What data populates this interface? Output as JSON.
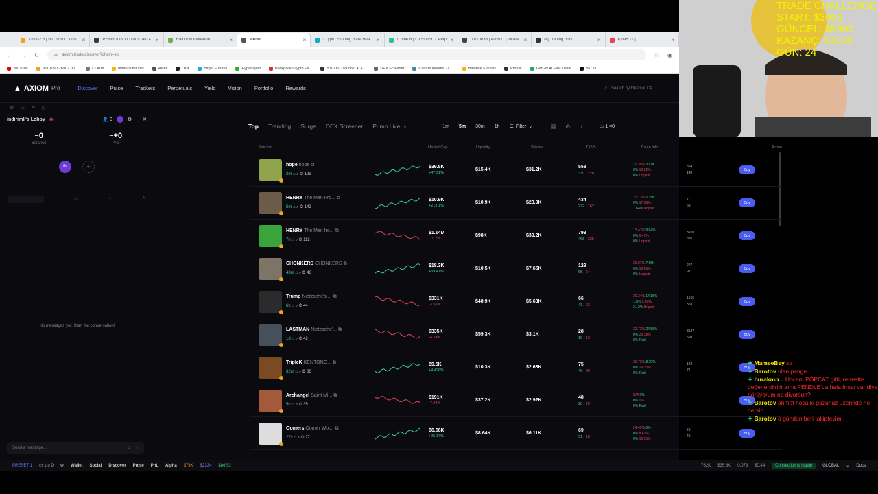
{
  "browser": {
    "tabs": [
      "78,032.5 | BTCUSD COIN",
      "PENGUUSDT 0.009148 ▲",
      "Rainbow İndikatörü",
      "Axiom",
      "Crypto Funding Rate Hea",
      "0.03408 | CTSI/USDT Perp",
      "0.010636 | 4USDT | Ticare",
      "My trading bots",
      "4,996.11 |"
    ],
    "active_tab": 3,
    "url": "axiom.trade/discover?chain=sol",
    "bookmarks": [
      "YouTube",
      "BTCUSD 26902.00...",
      "CLAIM",
      "binance futures",
      "Aster",
      "OKX",
      "Bitget Futures",
      "Hyperliquid",
      "Backpack Crypto Ex...",
      "BTCUSD 69.837 ▲ +...",
      "DEX Screener",
      "Coin Muhendisi - C...",
      "Binance Futures",
      "PropW",
      "GMGN AI Fast Trade",
      "BTCU"
    ]
  },
  "app": {
    "logo": "AXIOM",
    "logo_suffix": "Pro",
    "nav": [
      "Discover",
      "Pulse",
      "Trackers",
      "Perpetuals",
      "Yield",
      "Vision",
      "Portfolio",
      "Rewards"
    ],
    "active_nav": 0,
    "search_placeholder": "Search by token or CA...",
    "search_shortcut": "/",
    "lobby": {
      "title": "indirimli's Lobby",
      "count": "0",
      "balance": "0",
      "balance_label": "Balance",
      "pnl": "+0",
      "pnl_label": "PNL",
      "avatar": "IN",
      "empty": "No messages yet. Start the conversation!",
      "send_placeholder": "Send a message..."
    },
    "filters": {
      "tabs": [
        "Top",
        "Trending",
        "Surge",
        "DEX Screener",
        "Pump Live"
      ],
      "timeframes": [
        "1m",
        "5m",
        "30m",
        "1h"
      ],
      "active_tf": 1,
      "filter_label": "Filter",
      "count_label": "1",
      "zero_label": "0"
    },
    "columns": [
      "Pair Info",
      "Market Cap",
      "Liquidity",
      "Volume",
      "TXNS",
      "Token Info",
      "Action"
    ],
    "rows": [
      {
        "name": "hope",
        "sub": "hope",
        "age": "3m",
        "holders": "199",
        "mc": "$39.5K",
        "chg": "+47.91%",
        "dir": "up",
        "liq": "$15.4K",
        "vol": "$31.2K",
        "tx": "558",
        "buys": "330",
        "sells": "228",
        "i1": "22.39%",
        "i2": "3.91K",
        "i3": "0%",
        "i4": "18.22%",
        "i5": "0%",
        "i6": "Unpaid",
        "h1": "354",
        "h2": "143",
        "color": "#8fa34a"
      },
      {
        "name": "HENRY",
        "sub": "The Man Fro...",
        "age": "5m",
        "holders": "142",
        "mc": "$10.9K",
        "chg": "+213.1%",
        "dir": "up",
        "liq": "$10.9K",
        "vol": "$23.9K",
        "tx": "434",
        "buys": "272",
        "sells": "162",
        "i1": "23.12%",
        "i2": "2.38K",
        "i3": "0%",
        "i4": "17.58%",
        "i5": "1.64%",
        "i6": "Unpaid",
        "h1": "111",
        "h2": "63",
        "color": "#6b5c4a"
      },
      {
        "name": "HENRY",
        "sub": "The Man fro...",
        "age": "7h",
        "holders": "112",
        "mc": "$1.14M",
        "chg": "-10.7%",
        "dir": "down",
        "liq": "$98K",
        "vol": "$39.2K",
        "tx": "793",
        "buys": "468",
        "sells": "325",
        "i1": "13.41%",
        "i2": "9.64%",
        "i3": "0%",
        "i4": "6.47%",
        "i5": "0%",
        "i6": "Unpaid",
        "h1": "3910",
        "h2": "835",
        "color": "#3aa33c"
      },
      {
        "name": "CHONKERS",
        "sub": "CHONKERS",
        "age": "43m",
        "holders": "46",
        "mc": "$18.3K",
        "chg": "+59.41%",
        "dir": "up",
        "liq": "$10.5K",
        "vol": "$7.65K",
        "tx": "129",
        "buys": "65",
        "sells": "64",
        "i1": "20.07%",
        "i2": "7.65K",
        "i3": "0%",
        "i4": "16.86%",
        "i5": "0%",
        "i6": "Unpaid",
        "h1": "257",
        "h2": "92",
        "color": "#7d7466"
      },
      {
        "name": "Trump",
        "sub": "Nietzsche's ...",
        "age": "6h",
        "holders": "44",
        "mc": "$331K",
        "chg": "-3.56%",
        "dir": "down",
        "liq": "$48.9K",
        "vol": "$5.63K",
        "tx": "66",
        "buys": "43",
        "sells": "23",
        "i1": "20.34%",
        "i2": "14.18%",
        "i3": "1.8%",
        "i4": "2.43%",
        "i5": "2.12%",
        "i6": "Unpaid",
        "h1": "1565",
        "h2": "369",
        "color": "#2b2b2b"
      },
      {
        "name": "LASTMAN",
        "sub": "Nietzsche'...",
        "age": "1d",
        "holders": "42",
        "mc": "$335K",
        "chg": "-4.24%",
        "dir": "down",
        "liq": "$59.3K",
        "vol": "$3.1K",
        "tx": "28",
        "buys": "16",
        "sells": "12",
        "i1": "32.72%",
        "i2": "24.88%",
        "i3": "0%",
        "i4": "23.18%",
        "i5": "0%",
        "i6": "Paid",
        "h1": "3137",
        "h2": "599",
        "color": "#45505a"
      },
      {
        "name": "TripleK",
        "sub": "KENTONG...",
        "age": "32m",
        "holders": "36",
        "mc": "$9.5K",
        "chg": "+4.428%",
        "dir": "up",
        "liq": "$10.3K",
        "vol": "$2.63K",
        "tx": "75",
        "buys": "46",
        "sells": "29",
        "i1": "20.72%",
        "i2": "8.29%",
        "i3": "0%",
        "i4": "19.25%",
        "i5": "0%",
        "i6": "Paid",
        "h1": "149",
        "h2": "71",
        "color": "#7a4b22"
      },
      {
        "name": "Archangel",
        "sub": "Saint Mi...",
        "age": "5h",
        "holders": "35",
        "mc": "$191K",
        "chg": "-7.84%",
        "dir": "down",
        "liq": "$37.2K",
        "vol": "$2.92K",
        "tx": "48",
        "buys": "28",
        "sells": "20",
        "i1": "N/A",
        "i2": "0%",
        "i3": "0%",
        "i4": "0%",
        "i5": "0%",
        "i6": "Paid",
        "h1": "",
        "h2": "",
        "color": "#a35a3a"
      },
      {
        "name": "Oomers",
        "sub": "Oomer Woj...",
        "age": "27s",
        "holders": "27",
        "mc": "$6.66K",
        "chg": "+25.17%",
        "dir": "up",
        "liq": "$8.64K",
        "vol": "$6.11K",
        "tx": "69",
        "buys": "51",
        "sells": "18",
        "i1": "24.49%",
        "i2": "0%",
        "i3": "0%",
        "i4": "8.43%",
        "i5": "0%",
        "i6": "16.55%",
        "h1": "59",
        "h2": "49",
        "color": "#ddd"
      }
    ],
    "buy_label": "Buy",
    "bottom": {
      "preset": "PRESET 1",
      "one": "1",
      "zero": "0",
      "items": [
        "Wallet",
        "Social",
        "Discover",
        "Pulse",
        "PnL",
        "Alpha"
      ],
      "btc": "$78K",
      "eth": "$2334",
      "sol": "$86.53",
      "stats": [
        "762K",
        "$35.6K",
        "0.073",
        "$0.44"
      ],
      "stable": "Connection is stable",
      "global": "GLOBAL",
      "docs": "Docs"
    }
  },
  "overlay": {
    "lines": [
      "TRADE CHALLENGE",
      "START: $3000",
      "GÜNCEL: $5300",
      "KAZANÇ: $2300",
      "GÜN: 24"
    ],
    "chat": [
      {
        "user": "MameeBey",
        "msg": "sa"
      },
      {
        "user": "Barotov",
        "msg": "ulan penge"
      },
      {
        "user": "burakmn...",
        "msg": "Hocam POPCAT gitti, re-testte değerlendirilir ama PENDLE'da hala fırsat var diye görüyorum ne diyorsun?"
      },
      {
        "user": "Barotov",
        "msg": "ahmet hoca ki gözünüz üzerinde ne dersin"
      },
      {
        "user": "Barotov",
        "msg": "o günden beri takipteyim"
      }
    ]
  }
}
